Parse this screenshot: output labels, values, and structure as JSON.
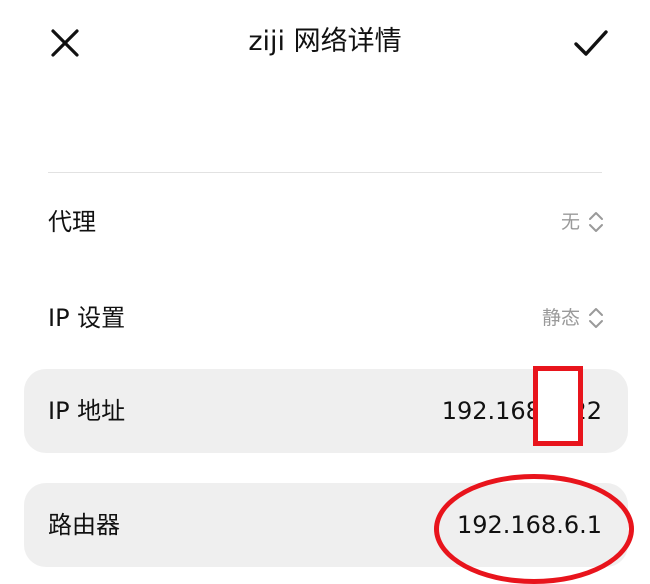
{
  "header": {
    "title": "ziji 网络详情",
    "close_icon": "close-icon",
    "confirm_icon": "checkmark-icon"
  },
  "rows": {
    "proxy": {
      "label": "代理",
      "value": "无"
    },
    "ip_settings": {
      "label": "IP 设置",
      "value": "静态"
    },
    "ip_address": {
      "label": "IP 地址",
      "value": "192.168.6.22"
    },
    "router": {
      "label": "路由器",
      "value": "192.168.6.1"
    }
  },
  "colors": {
    "highlight_bg": "#efefef",
    "annotation_red": "#e8141c",
    "secondary_text": "#9a9a9a"
  }
}
